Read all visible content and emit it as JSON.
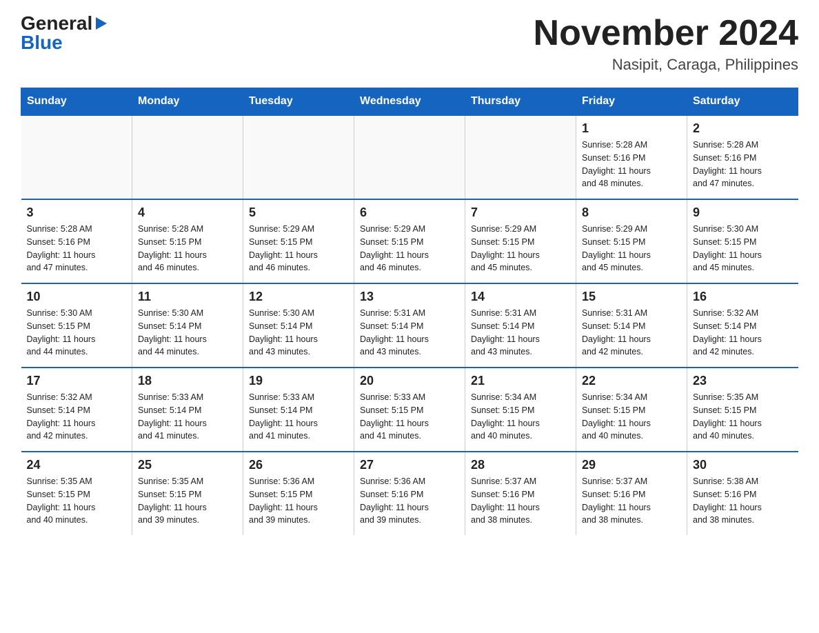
{
  "logo": {
    "general": "General",
    "blue": "Blue"
  },
  "header": {
    "month_year": "November 2024",
    "location": "Nasipit, Caraga, Philippines"
  },
  "weekdays": [
    "Sunday",
    "Monday",
    "Tuesday",
    "Wednesday",
    "Thursday",
    "Friday",
    "Saturday"
  ],
  "weeks": [
    [
      {
        "day": "",
        "info": ""
      },
      {
        "day": "",
        "info": ""
      },
      {
        "day": "",
        "info": ""
      },
      {
        "day": "",
        "info": ""
      },
      {
        "day": "",
        "info": ""
      },
      {
        "day": "1",
        "info": "Sunrise: 5:28 AM\nSunset: 5:16 PM\nDaylight: 11 hours\nand 48 minutes."
      },
      {
        "day": "2",
        "info": "Sunrise: 5:28 AM\nSunset: 5:16 PM\nDaylight: 11 hours\nand 47 minutes."
      }
    ],
    [
      {
        "day": "3",
        "info": "Sunrise: 5:28 AM\nSunset: 5:16 PM\nDaylight: 11 hours\nand 47 minutes."
      },
      {
        "day": "4",
        "info": "Sunrise: 5:28 AM\nSunset: 5:15 PM\nDaylight: 11 hours\nand 46 minutes."
      },
      {
        "day": "5",
        "info": "Sunrise: 5:29 AM\nSunset: 5:15 PM\nDaylight: 11 hours\nand 46 minutes."
      },
      {
        "day": "6",
        "info": "Sunrise: 5:29 AM\nSunset: 5:15 PM\nDaylight: 11 hours\nand 46 minutes."
      },
      {
        "day": "7",
        "info": "Sunrise: 5:29 AM\nSunset: 5:15 PM\nDaylight: 11 hours\nand 45 minutes."
      },
      {
        "day": "8",
        "info": "Sunrise: 5:29 AM\nSunset: 5:15 PM\nDaylight: 11 hours\nand 45 minutes."
      },
      {
        "day": "9",
        "info": "Sunrise: 5:30 AM\nSunset: 5:15 PM\nDaylight: 11 hours\nand 45 minutes."
      }
    ],
    [
      {
        "day": "10",
        "info": "Sunrise: 5:30 AM\nSunset: 5:15 PM\nDaylight: 11 hours\nand 44 minutes."
      },
      {
        "day": "11",
        "info": "Sunrise: 5:30 AM\nSunset: 5:14 PM\nDaylight: 11 hours\nand 44 minutes."
      },
      {
        "day": "12",
        "info": "Sunrise: 5:30 AM\nSunset: 5:14 PM\nDaylight: 11 hours\nand 43 minutes."
      },
      {
        "day": "13",
        "info": "Sunrise: 5:31 AM\nSunset: 5:14 PM\nDaylight: 11 hours\nand 43 minutes."
      },
      {
        "day": "14",
        "info": "Sunrise: 5:31 AM\nSunset: 5:14 PM\nDaylight: 11 hours\nand 43 minutes."
      },
      {
        "day": "15",
        "info": "Sunrise: 5:31 AM\nSunset: 5:14 PM\nDaylight: 11 hours\nand 42 minutes."
      },
      {
        "day": "16",
        "info": "Sunrise: 5:32 AM\nSunset: 5:14 PM\nDaylight: 11 hours\nand 42 minutes."
      }
    ],
    [
      {
        "day": "17",
        "info": "Sunrise: 5:32 AM\nSunset: 5:14 PM\nDaylight: 11 hours\nand 42 minutes."
      },
      {
        "day": "18",
        "info": "Sunrise: 5:33 AM\nSunset: 5:14 PM\nDaylight: 11 hours\nand 41 minutes."
      },
      {
        "day": "19",
        "info": "Sunrise: 5:33 AM\nSunset: 5:14 PM\nDaylight: 11 hours\nand 41 minutes."
      },
      {
        "day": "20",
        "info": "Sunrise: 5:33 AM\nSunset: 5:15 PM\nDaylight: 11 hours\nand 41 minutes."
      },
      {
        "day": "21",
        "info": "Sunrise: 5:34 AM\nSunset: 5:15 PM\nDaylight: 11 hours\nand 40 minutes."
      },
      {
        "day": "22",
        "info": "Sunrise: 5:34 AM\nSunset: 5:15 PM\nDaylight: 11 hours\nand 40 minutes."
      },
      {
        "day": "23",
        "info": "Sunrise: 5:35 AM\nSunset: 5:15 PM\nDaylight: 11 hours\nand 40 minutes."
      }
    ],
    [
      {
        "day": "24",
        "info": "Sunrise: 5:35 AM\nSunset: 5:15 PM\nDaylight: 11 hours\nand 40 minutes."
      },
      {
        "day": "25",
        "info": "Sunrise: 5:35 AM\nSunset: 5:15 PM\nDaylight: 11 hours\nand 39 minutes."
      },
      {
        "day": "26",
        "info": "Sunrise: 5:36 AM\nSunset: 5:15 PM\nDaylight: 11 hours\nand 39 minutes."
      },
      {
        "day": "27",
        "info": "Sunrise: 5:36 AM\nSunset: 5:16 PM\nDaylight: 11 hours\nand 39 minutes."
      },
      {
        "day": "28",
        "info": "Sunrise: 5:37 AM\nSunset: 5:16 PM\nDaylight: 11 hours\nand 38 minutes."
      },
      {
        "day": "29",
        "info": "Sunrise: 5:37 AM\nSunset: 5:16 PM\nDaylight: 11 hours\nand 38 minutes."
      },
      {
        "day": "30",
        "info": "Sunrise: 5:38 AM\nSunset: 5:16 PM\nDaylight: 11 hours\nand 38 minutes."
      }
    ]
  ]
}
